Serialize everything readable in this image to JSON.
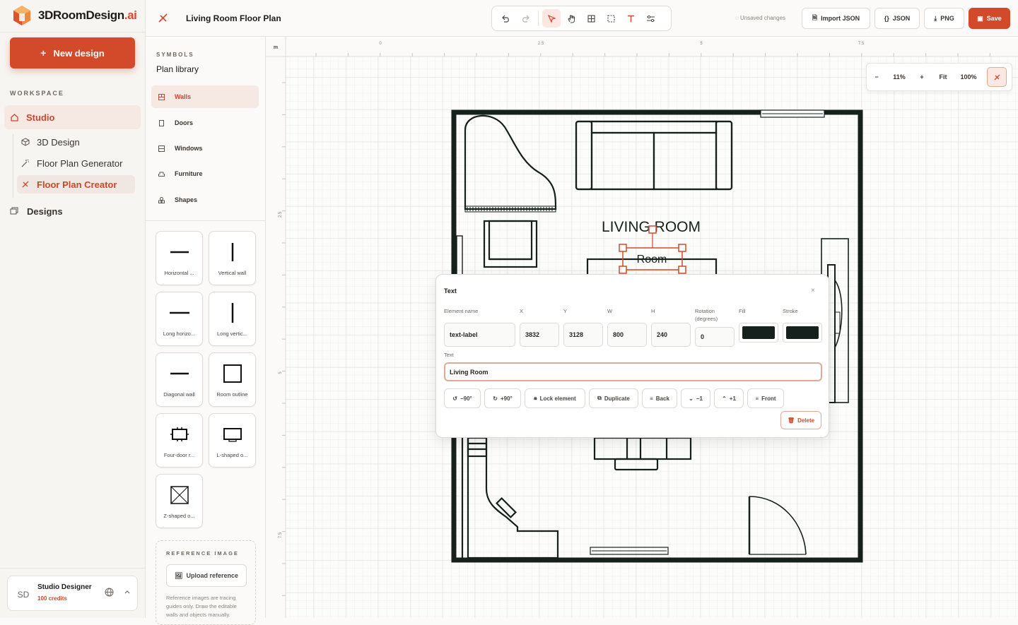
{
  "brand": {
    "name_main": "3DRoomDesign",
    "name_suffix": ".ai"
  },
  "sidebar": {
    "new_design_label": "New design",
    "workspace_label": "WORKSPACE",
    "studio_label": "Studio",
    "items": [
      {
        "label": "3D Design",
        "icon": "cube-icon"
      },
      {
        "label": "Floor Plan Generator",
        "icon": "magic-wand-icon"
      },
      {
        "label": "Floor Plan Creator",
        "icon": "ruler-pencil-icon"
      }
    ],
    "designs_label": "Designs",
    "user": {
      "initials": "SD",
      "name": "Studio Designer",
      "credits": "100 credits"
    }
  },
  "topbar": {
    "title": "Living Room Floor Plan",
    "unsaved": "Unsaved changes",
    "import_json": "Import JSON",
    "json": "JSON",
    "png": "PNG",
    "save": "Save"
  },
  "library": {
    "section_label": "SYMBOLS",
    "title": "Plan library",
    "categories": [
      "Walls",
      "Doors",
      "Windows",
      "Furniture",
      "Shapes"
    ],
    "tiles": [
      "Horizontal ...",
      "Vertical wall",
      "Long horizo...",
      "Long vertic...",
      "Diagonal wall",
      "Room outline",
      "Four-door r...",
      "L-shaped o...",
      "Z-shaped o..."
    ],
    "reference": {
      "label": "REFERENCE IMAGE",
      "upload": "Upload reference",
      "note": "Reference images are tracing guides only. Draw the editable walls and objects manually."
    }
  },
  "canvas": {
    "unit": "m",
    "ruler_top": [
      "0",
      "2.5",
      "5",
      "7.5"
    ],
    "ruler_left": [
      "2.5",
      "5",
      "7.5"
    ],
    "zoom": {
      "minus": "−",
      "level": "11%",
      "plus": "+",
      "fit": "Fit",
      "reset": "100%"
    },
    "room_label": "LIVING ROOM",
    "selected_text": "Room"
  },
  "panel": {
    "title": "Text",
    "labels": {
      "name": "Element name",
      "x": "X",
      "y": "Y",
      "w": "W",
      "h": "H",
      "rotation": "Rotation (degrees)",
      "fill": "Fill",
      "stroke": "Stroke",
      "text": "Text"
    },
    "values": {
      "name": "text-label",
      "x": "3832",
      "y": "3128",
      "w": "800",
      "h": "240",
      "rotation": "0",
      "text": "Living Room"
    },
    "fill_color": "#16211d",
    "stroke_color": "#16211d",
    "buttons": {
      "rot_minus": "−90°",
      "rot_plus": "+90°",
      "lock": "Lock element",
      "duplicate": "Duplicate",
      "back": "Back",
      "minus1": "−1",
      "plus1": "+1",
      "front": "Front",
      "delete": "Delete"
    }
  },
  "colors": {
    "accent": "#d24a2a",
    "ink": "#16211d"
  }
}
